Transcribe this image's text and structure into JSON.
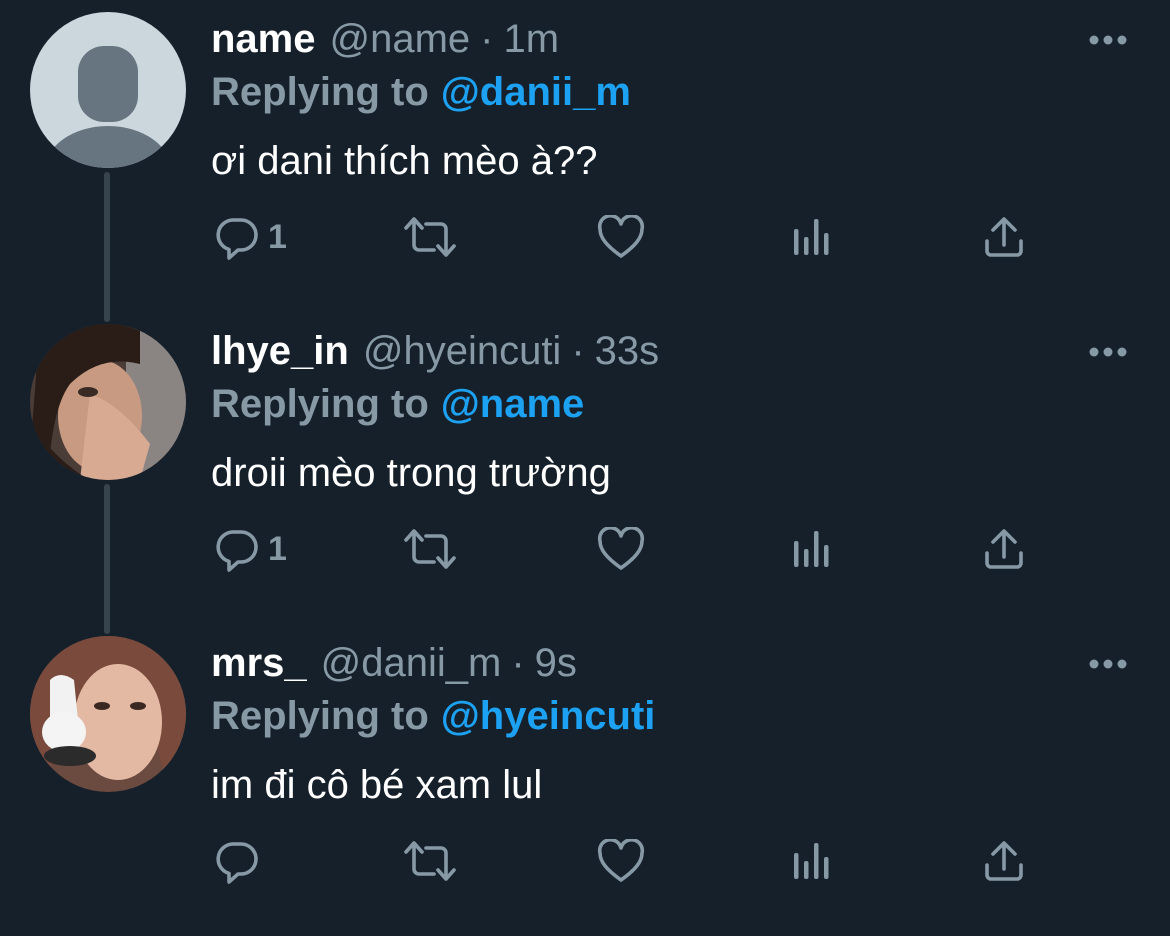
{
  "theme": {
    "background": "#15202b",
    "text_primary": "#ffffff",
    "text_secondary": "#8899a6",
    "accent": "#1da1f2",
    "thread_line": "#38444d"
  },
  "tweets": [
    {
      "display_name": "name",
      "handle": "@name",
      "separator": "·",
      "time": "1m",
      "reply_label": "Replying to",
      "reply_to": "@danii_m",
      "text": "ơi dani thích mèo à??",
      "reply_count": "1",
      "avatar": "default-profile-avatar",
      "actions": [
        "reply-icon",
        "retweet-icon",
        "like-icon",
        "analytics-icon",
        "share-icon"
      ]
    },
    {
      "display_name": "lhye_in",
      "handle": "@hyeincuti",
      "separator": "·",
      "time": "33s",
      "reply_label": "Replying to",
      "reply_to": "@name",
      "text": "droii mèo trong trường",
      "reply_count": "1",
      "avatar": "profile-photo",
      "actions": [
        "reply-icon",
        "retweet-icon",
        "like-icon",
        "analytics-icon",
        "share-icon"
      ]
    },
    {
      "display_name": "mrs_",
      "handle": "@danii_m",
      "separator": "·",
      "time": "9s",
      "reply_label": "Replying to",
      "reply_to": "@hyeincuti",
      "text": "im đi cô bé xam lul",
      "reply_count": "",
      "avatar": "profile-photo",
      "actions": [
        "reply-icon",
        "retweet-icon",
        "like-icon",
        "analytics-icon",
        "share-icon"
      ]
    }
  ]
}
